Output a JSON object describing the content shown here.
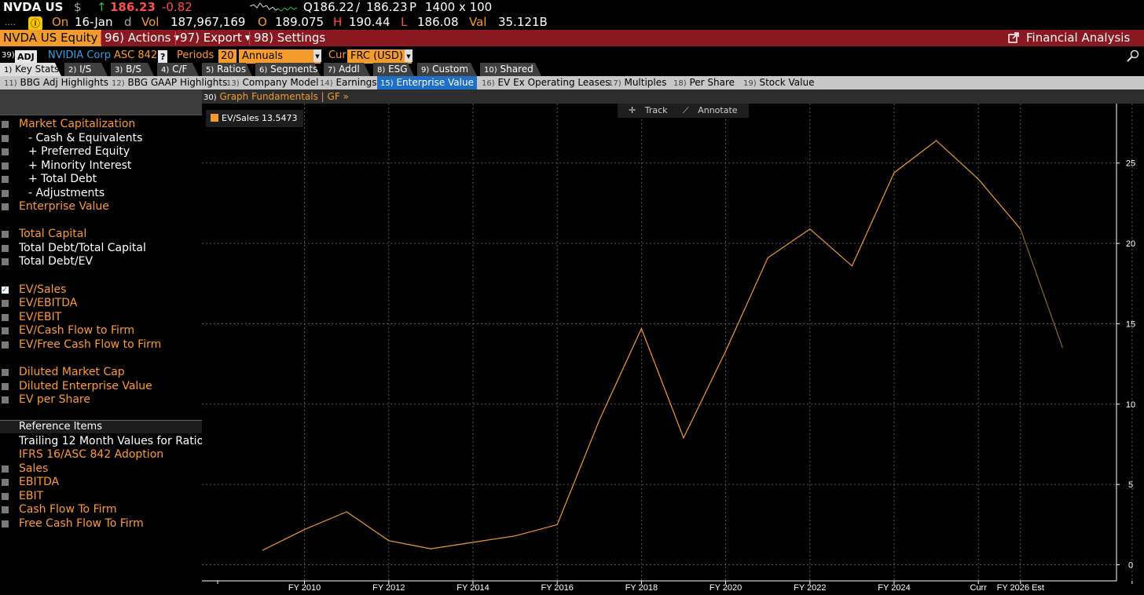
{
  "quote": {
    "ticker": "NVDA US",
    "currency_symbol": "$",
    "arrow": "↑",
    "last": "186.23",
    "change": "-0.82",
    "bid_ask_prefix": "Q",
    "bid": "186.22",
    "ask": "186.23",
    "ask_suffix": "P",
    "size": "1400 x 100",
    "dots": "....",
    "info_badge": "Ⓘ",
    "on_label": "On",
    "date": "16-Jan",
    "d_label": "d",
    "vol_label": "Vol",
    "volume": "187,967,169",
    "open_label": "O",
    "open": "189.075",
    "high_label": "H",
    "high": "190.44",
    "low_label": "L",
    "low": "186.08",
    "val_label": "Val",
    "value": "35.121B"
  },
  "toolbar": {
    "security": "NVDA US Equity",
    "actions": "96) Actions",
    "export": "97) Export",
    "settings": "98) Settings",
    "app_title": "Financial Analysis"
  },
  "company_row": {
    "num": "39)",
    "adj": "ADJ",
    "company": "NVIDIA Corp",
    "asc": "ASC 842",
    "help": "?",
    "periods_label": "Periods",
    "periods": "20",
    "period_type": "Annuals",
    "cur_label": "Cur",
    "currency": "FRC (USD)"
  },
  "tabs1": [
    {
      "n": "1)",
      "label": "Key Stats"
    },
    {
      "n": "2)",
      "label": "I/S"
    },
    {
      "n": "3)",
      "label": "B/S"
    },
    {
      "n": "4)",
      "label": "C/F"
    },
    {
      "n": "5)",
      "label": "Ratios"
    },
    {
      "n": "6)",
      "label": "Segments"
    },
    {
      "n": "7)",
      "label": "Addl"
    },
    {
      "n": "8)",
      "label": "ESG"
    },
    {
      "n": "9)",
      "label": "Custom"
    },
    {
      "n": "10)",
      "label": "Shared"
    }
  ],
  "tabs2": [
    {
      "n": "11)",
      "label": "BBG Adj Highlights"
    },
    {
      "n": "12)",
      "label": "BBG GAAP Highlights"
    },
    {
      "n": "13)",
      "label": "Company Model"
    },
    {
      "n": "14)",
      "label": "Earnings"
    },
    {
      "n": "15)",
      "label": "Enterprise Value"
    },
    {
      "n": "16)",
      "label": "EV Ex Operating Leases"
    },
    {
      "n": "17)",
      "label": "Multiples"
    },
    {
      "n": "18)",
      "label": "Per Share"
    },
    {
      "n": "19)",
      "label": "Stock Value"
    }
  ],
  "graph_bar": {
    "n": "30)",
    "label": "Graph Fundamentals | GF »"
  },
  "left_items": {
    "market_cap": "Market Capitalization",
    "cash": "- Cash & Equivalents",
    "pref": "+ Preferred Equity",
    "minority": "+ Minority Interest",
    "debt": "+ Total Debt",
    "adjust": "- Adjustments",
    "ev": "Enterprise Value",
    "total_capital": "Total Capital",
    "debt_capital": "Total Debt/Total Capital",
    "debt_ev": "Total Debt/EV",
    "ev_sales": "EV/Sales",
    "ev_ebitda": "EV/EBITDA",
    "ev_ebit": "EV/EBIT",
    "ev_cf": "EV/Cash Flow to Firm",
    "ev_fcf": "EV/Free Cash Flow to Firm",
    "diluted_mc": "Diluted Market Cap",
    "diluted_ev": "Diluted Enterprise Value",
    "ev_share": "EV per Share",
    "ref_header": "Reference Items",
    "ttm": "Trailing 12 Month Values for Ratios",
    "ifrs": "IFRS 16/ASC 842 Adoption",
    "sales": "Sales",
    "ebitda": "EBITDA",
    "ebit": "EBIT",
    "cff": "Cash Flow To Firm",
    "fcff": "Free Cash Flow To Firm"
  },
  "chart_tools": {
    "track": "Track",
    "annotate": "Annotate",
    "track_icon": "crosshair-icon",
    "annotate_icon": "pencil-icon"
  },
  "chart_data": {
    "type": "line",
    "legend": {
      "name": "EV/Sales",
      "value": "13.5473",
      "placement": "top-left"
    },
    "x": [
      "FY 2009",
      "FY 2010",
      "FY 2011",
      "FY 2012",
      "FY 2013",
      "FY 2014",
      "FY 2015",
      "FY 2016",
      "FY 2017",
      "FY 2018",
      "FY 2019",
      "FY 2020",
      "FY 2021",
      "FY 2022",
      "FY 2023",
      "FY 2024",
      "FY 2025",
      "Curr",
      "FY 2026 Est",
      "FY 2027 Est"
    ],
    "x_tick_labels": [
      "FY 2010",
      "FY 2012",
      "FY 2014",
      "FY 2016",
      "FY 2018",
      "FY 2020",
      "FY 2022",
      "FY 2024",
      "Curr",
      "FY 2026 Est"
    ],
    "series": [
      {
        "name": "EV/Sales",
        "color": "#f39b2c",
        "values": [
          0.9,
          2.2,
          3.3,
          1.5,
          1.0,
          1.4,
          1.8,
          2.5,
          9.0,
          14.7,
          7.9,
          13.3,
          19.1,
          20.9,
          18.6,
          24.4,
          26.4,
          24.0,
          20.9,
          13.5
        ]
      }
    ],
    "estimate_start": "FY 2026 Est",
    "estimate_color": "#8a6a30",
    "y_ticks": [
      0,
      5,
      10,
      15,
      20,
      25
    ],
    "ylim": [
      -1.0,
      28.7
    ],
    "grid": true,
    "colors": {
      "background": "#000000",
      "grid": "#5a5a5a",
      "axis": "#ffffff",
      "tick_label": "#ffffff"
    }
  }
}
